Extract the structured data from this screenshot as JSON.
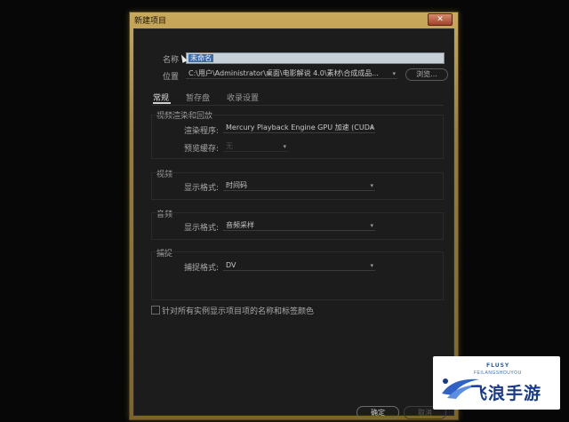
{
  "dialog": {
    "title": "新建项目",
    "close_icon_glyph": "✕"
  },
  "project": {
    "name_label": "名称",
    "name_value": "未命名",
    "location_label": "位置",
    "location_value": "C:\\用户\\Administrator\\桌面\\电影解说 4.0\\素材\\合成成品...",
    "browse_label": "浏览..."
  },
  "tabs": [
    {
      "label": "常规",
      "active": true
    },
    {
      "label": "暂存盘",
      "active": false
    },
    {
      "label": "收录设置",
      "active": false
    }
  ],
  "video_rendering": {
    "group_label": "视频渲染和回放",
    "renderer_label": "渲染程序:",
    "renderer_value": "Mercury Playback Engine GPU 加速 (CUDA)",
    "preview_cache_label": "预览缓存:",
    "preview_cache_value": "无"
  },
  "video": {
    "group_label": "视频",
    "display_format_label": "显示格式:",
    "display_format_value": "时间码"
  },
  "audio": {
    "group_label": "音频",
    "display_format_label": "显示格式:",
    "display_format_value": "音频采样"
  },
  "capture": {
    "group_label": "捕捉",
    "capture_format_label": "捕捉格式:",
    "capture_format_value": "DV"
  },
  "option": {
    "checkbox_label": "针对所有实例显示项目项的名称和标签颜色",
    "checked": false
  },
  "buttons": {
    "ok_label": "确定",
    "cancel_label": "取消"
  },
  "watermark": {
    "text_en_top": "FLUSY",
    "text_en": "FEILANGSHOUYOU",
    "text_cn": "飞浪手游"
  },
  "colors": {
    "frame_gold": "#9c7d37",
    "client_bg": "#1c1c1c",
    "selection": "#3d6ea6"
  }
}
